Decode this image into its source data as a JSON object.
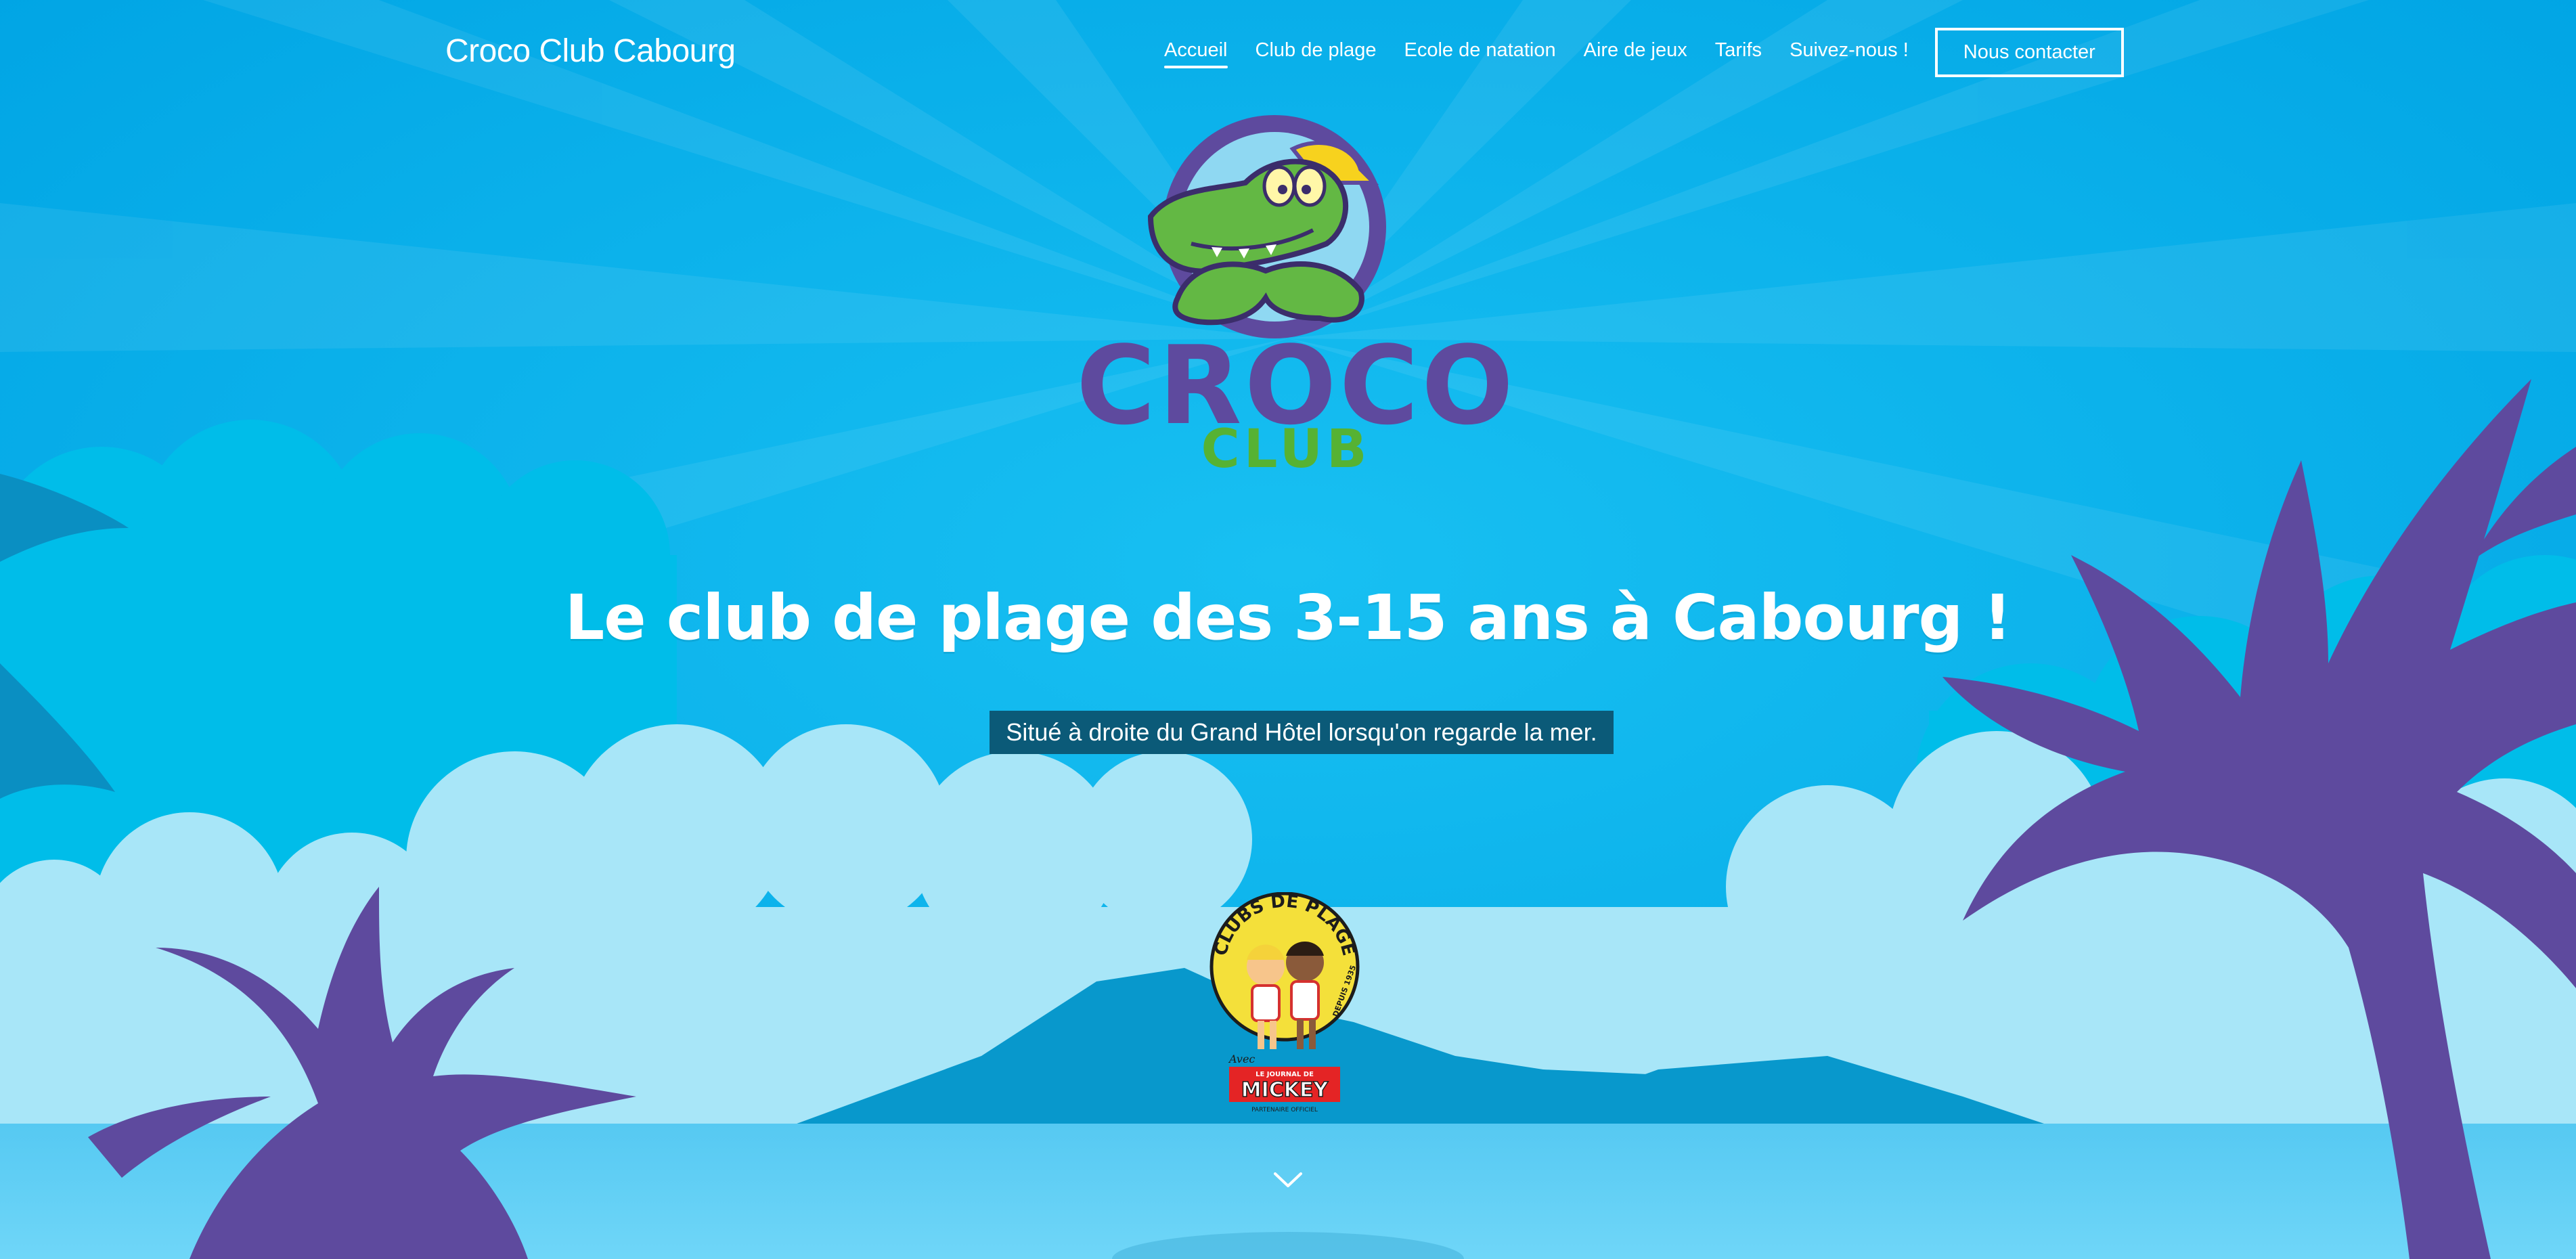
{
  "header": {
    "site_title": "Croco Club Cabourg",
    "nav": [
      {
        "label": "Accueil",
        "active": true
      },
      {
        "label": "Club de plage",
        "active": false
      },
      {
        "label": "Ecole de natation",
        "active": false
      },
      {
        "label": "Aire de jeux",
        "active": false
      },
      {
        "label": "Tarifs",
        "active": false
      },
      {
        "label": "Suivez-nous !",
        "active": false
      }
    ],
    "contact_button": "Nous contacter"
  },
  "logo": {
    "word_top": "CROCO",
    "word_bottom": "CLUB"
  },
  "hero": {
    "heading": "Le club de plage des 3-15 ans à Cabourg !",
    "location_note": "Situé à droite du Grand Hôtel lorsqu'on regarde la mer."
  },
  "partner_badge": {
    "top_text": "CLUBS DE PLAGE",
    "side_text": "DEPUIS 1935",
    "prefix": "Avec",
    "small_text": "LE JOURNAL DE",
    "brand": "MICKEY",
    "bottom_text": "PARTENAIRE OFFICIEL"
  },
  "icons": {
    "scroll": "chevron-down-icon"
  },
  "colors": {
    "sky": "#00aee8",
    "palm": "#5e4a9e",
    "cloud_light": "#a8e6f8",
    "sea": "#5fd0f5",
    "logo_green": "#56b233"
  }
}
